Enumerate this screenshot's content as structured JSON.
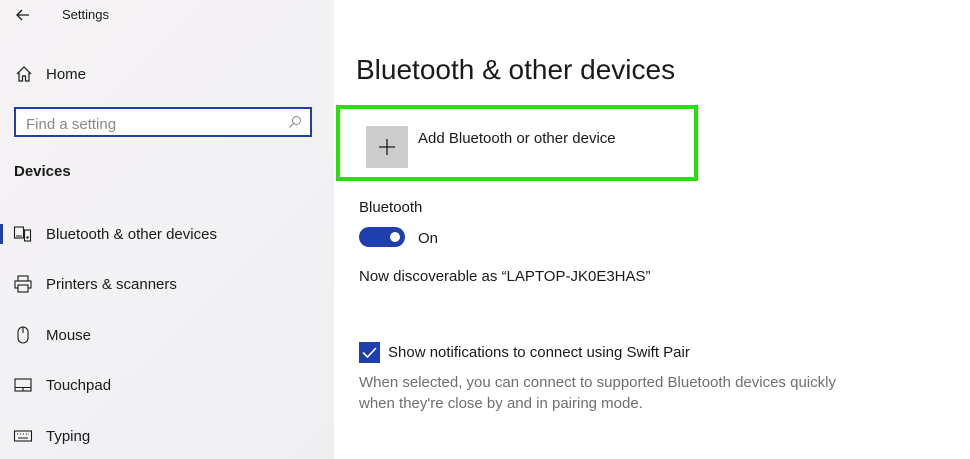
{
  "window": {
    "title": "Settings"
  },
  "sidebar": {
    "home_label": "Home",
    "search_placeholder": "Find a setting",
    "section_title": "Devices",
    "items": [
      {
        "label": "Bluetooth & other devices",
        "icon": "bluetooth-devices-icon",
        "active": true
      },
      {
        "label": "Printers & scanners",
        "icon": "printer-icon",
        "active": false
      },
      {
        "label": "Mouse",
        "icon": "mouse-icon",
        "active": false
      },
      {
        "label": "Touchpad",
        "icon": "touchpad-icon",
        "active": false
      },
      {
        "label": "Typing",
        "icon": "keyboard-icon",
        "active": false
      }
    ]
  },
  "main": {
    "title": "Bluetooth & other devices",
    "add_device_label": "Add Bluetooth or other device",
    "bluetooth_label": "Bluetooth",
    "bluetooth_state": "On",
    "bluetooth_on": true,
    "discoverable_text": "Now discoverable as “LAPTOP-JK0E3HAS”",
    "swift_pair_label": "Show notifications to connect using Swift Pair",
    "swift_pair_checked": true,
    "swift_pair_description": "When selected, you can connect to supported Bluetooth devices quickly when they're close by and in pairing mode."
  },
  "colors": {
    "accent": "#1f3fae",
    "highlight": "#22e400"
  }
}
